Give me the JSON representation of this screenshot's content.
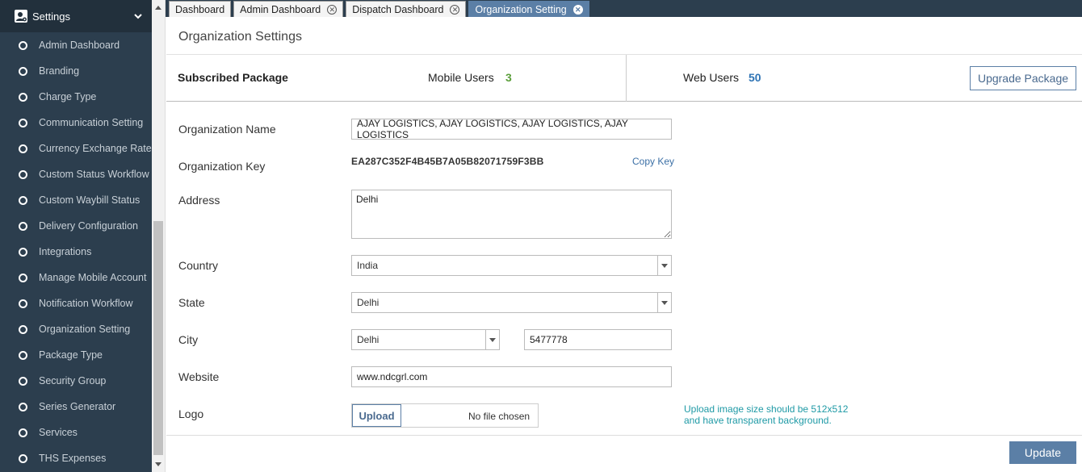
{
  "sidebar": {
    "header": "Settings",
    "items": [
      {
        "label": "Admin Dashboard"
      },
      {
        "label": "Branding"
      },
      {
        "label": "Charge Type"
      },
      {
        "label": "Communication Setting"
      },
      {
        "label": "Currency Exchange Rate"
      },
      {
        "label": "Custom Status Workflow"
      },
      {
        "label": "Custom Waybill Status"
      },
      {
        "label": "Delivery Configuration"
      },
      {
        "label": "Integrations"
      },
      {
        "label": "Manage Mobile Account"
      },
      {
        "label": "Notification Workflow"
      },
      {
        "label": "Organization Setting"
      },
      {
        "label": "Package Type"
      },
      {
        "label": "Security Group"
      },
      {
        "label": "Series Generator"
      },
      {
        "label": "Services"
      },
      {
        "label": "THS Expenses"
      }
    ]
  },
  "tabs": [
    {
      "label": "Dashboard",
      "closable": false
    },
    {
      "label": "Admin Dashboard",
      "closable": true
    },
    {
      "label": "Dispatch Dashboard",
      "closable": true
    },
    {
      "label": "Organization Setting",
      "closable": true,
      "active": true
    }
  ],
  "page": {
    "title": "Organization Settings"
  },
  "package": {
    "subscribed_label": "Subscribed Package",
    "mobile_label": "Mobile Users",
    "mobile_value": "3",
    "mobile_color": "#5a9e3a",
    "web_label": "Web Users",
    "web_value": "50",
    "web_color": "#2f74b5",
    "upgrade_label": "Upgrade Package"
  },
  "form": {
    "org_name_label": "Organization Name",
    "org_name_value": "AJAY LOGISTICS, AJAY LOGISTICS, AJAY LOGISTICS, AJAY LOGISTICS",
    "org_key_label": "Organization Key",
    "org_key_value": "EA287C352F4B45B7A05B82071759F3BB",
    "copy_key_label": "Copy Key",
    "address_label": "Address",
    "address_value": "Delhi",
    "country_label": "Country",
    "country_value": "India",
    "state_label": "State",
    "state_value": "Delhi",
    "city_label": "City",
    "city_value": "Delhi",
    "pincode_value": "5477778",
    "website_label": "Website",
    "website_value": "www.ndcgrl.com",
    "logo_label": "Logo",
    "upload_label": "Upload",
    "no_file_label": "No file chosen",
    "upload_hint_1": "Upload image size should be 512x512",
    "upload_hint_2": "and have transparent background."
  },
  "footer": {
    "update_label": "Update"
  },
  "colors": {
    "sidebar_bg": "#2c3e4e",
    "accent": "#5b7fa6",
    "hint": "#1f9aa6"
  }
}
